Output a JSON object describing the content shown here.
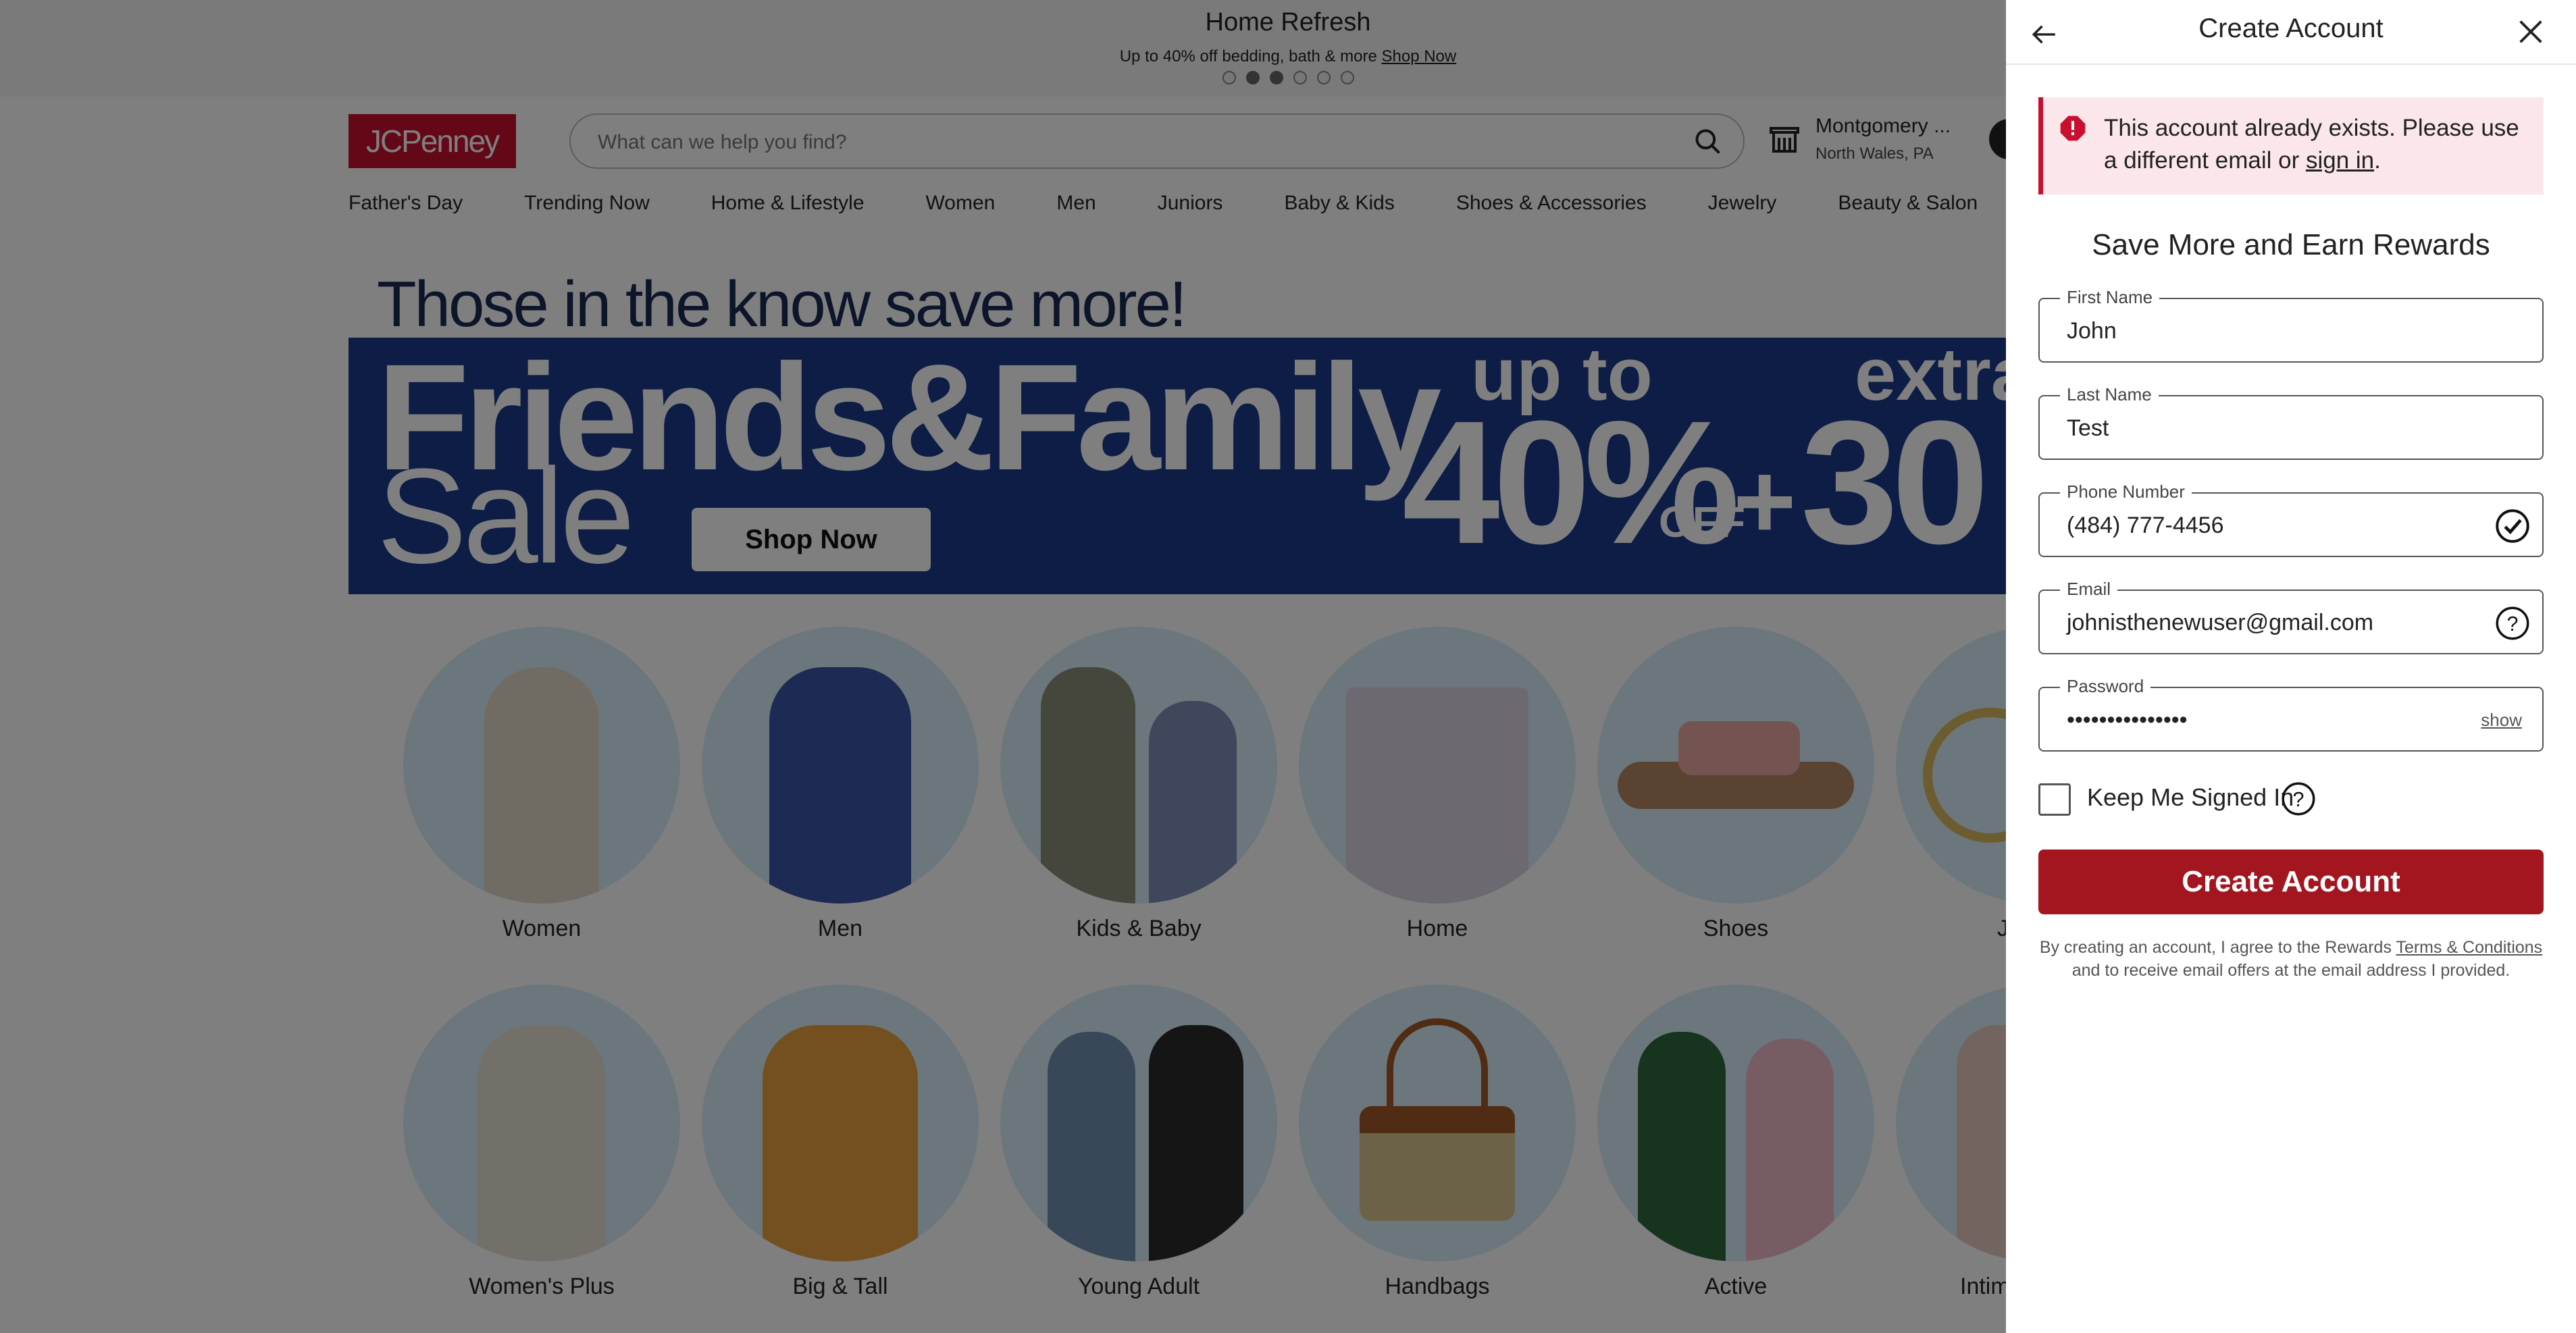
{
  "promo": {
    "title": "Home Refresh",
    "subtitle": "Up to 40% off bedding, bath & more",
    "link": "Shop Now"
  },
  "header": {
    "logo": "JCPenney",
    "search_placeholder": "What can we help you find?",
    "store_name": "Montgomery ...",
    "store_location": "North Wales, PA"
  },
  "nav": [
    "Father's Day",
    "Trending Now",
    "Home & Lifestyle",
    "Women",
    "Men",
    "Juniors",
    "Baby & Kids",
    "Shoes & Accessories",
    "Jewelry",
    "Beauty & Salon"
  ],
  "banner": {
    "headline": "Those in the know save more!",
    "line1": "Friends&Family",
    "line2": "Sale",
    "cta": "Shop Now",
    "upto": "up to",
    "pct": "40%",
    "off": "OFF",
    "plus": "+",
    "extra": "extra",
    "extra_pct": "30"
  },
  "categories_row1": [
    "Women",
    "Men",
    "Kids & Baby",
    "Home",
    "Shoes",
    "J"
  ],
  "categories_row2": [
    "Women's Plus",
    "Big & Tall",
    "Young Adult",
    "Handbags",
    "Active",
    "Intim"
  ],
  "drawer": {
    "title": "Create Account",
    "alert_text": "This account already exists. Please use a different email or ",
    "alert_link": "sign in",
    "alert_end": ".",
    "heading": "Save More and Earn Rewards",
    "first_name_label": "First Name",
    "first_name": "John",
    "last_name_label": "Last Name",
    "last_name": "Test",
    "phone_label": "Phone Number",
    "phone": "(484) 777-4456",
    "email_label": "Email",
    "email": "johnisthenewuser@gmail.com",
    "password_label": "Password",
    "password": "•••••••••••••••",
    "show": "show",
    "keep_signed_in": "Keep Me Signed In",
    "submit": "Create Account",
    "legal_1": "By creating an account, I agree to the Rewards ",
    "legal_link": "Terms & Conditions",
    "legal_2": "and to receive email offers at the email address I provided."
  },
  "colors": {
    "brand_red": "#c8102e",
    "button_red": "#a4161f",
    "alert_bg": "#fbe7e9",
    "banner_navy": "#1b3a8c",
    "circle_bg": "#d6eef8"
  }
}
